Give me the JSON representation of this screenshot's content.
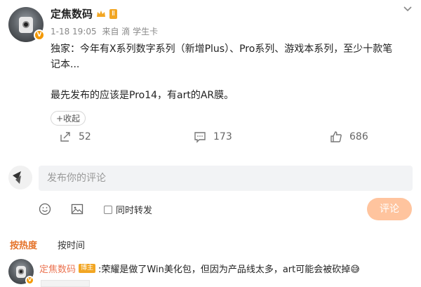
{
  "post": {
    "username": "定焦数码",
    "level_badge": "Ⅱ",
    "verified_badge": "V",
    "meta_time": "1-18 19:05",
    "meta_source": "来自 滴 学生卡",
    "text_line1": "独家：今年有X系列数字系列（新增Plus）、Pro系列、游戏本系列，至少十款笔",
    "text_line2": "记本...",
    "text_line3": "最先发布的应该是Pro14，有art的AR膜。",
    "expand_label": "+收起",
    "actions": {
      "share_count": "52",
      "comment_count": "173",
      "like_count": "686"
    }
  },
  "comment_box": {
    "placeholder": "发布你的评论",
    "repost_label": "同时转发",
    "submit_label": "评论"
  },
  "tabs": {
    "hot": "按热度",
    "time": "按时间"
  },
  "first_comment": {
    "username": "定焦数码",
    "badge": "博主",
    "text": ":荣耀是做了Win美化包，但因为产品线太多，art可能会被砍掉😅"
  },
  "icons": {
    "more": "chevron-down-icon",
    "share": "share-icon",
    "comment": "comment-icon",
    "like": "thumbs-up-icon",
    "emoji": "emoji-icon",
    "image": "image-icon"
  },
  "colors": {
    "accent": "#e5732a",
    "submit_disabled": "#ffc49e",
    "comment_user": "#eb7350"
  }
}
